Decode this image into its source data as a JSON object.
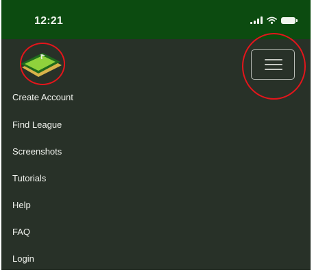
{
  "status_bar": {
    "time": "12:21",
    "icons": [
      "signal-icon",
      "wifi-icon",
      "battery-icon"
    ]
  },
  "header": {
    "logo": "league-logo",
    "menu_button_icon": "hamburger-menu-icon"
  },
  "nav": {
    "items": [
      {
        "label": "Create Account"
      },
      {
        "label": "Find League"
      },
      {
        "label": "Screenshots"
      },
      {
        "label": "Tutorials"
      },
      {
        "label": "Help"
      },
      {
        "label": "FAQ"
      },
      {
        "label": "Login"
      }
    ]
  },
  "colors": {
    "status_bar_bg": "#0c4b10",
    "page_bg": "#283128",
    "highlight_circle": "#e5151b",
    "logo_green": "#8fd23c",
    "logo_dark": "#1f6a1c",
    "logo_gold": "#d8b34a"
  }
}
